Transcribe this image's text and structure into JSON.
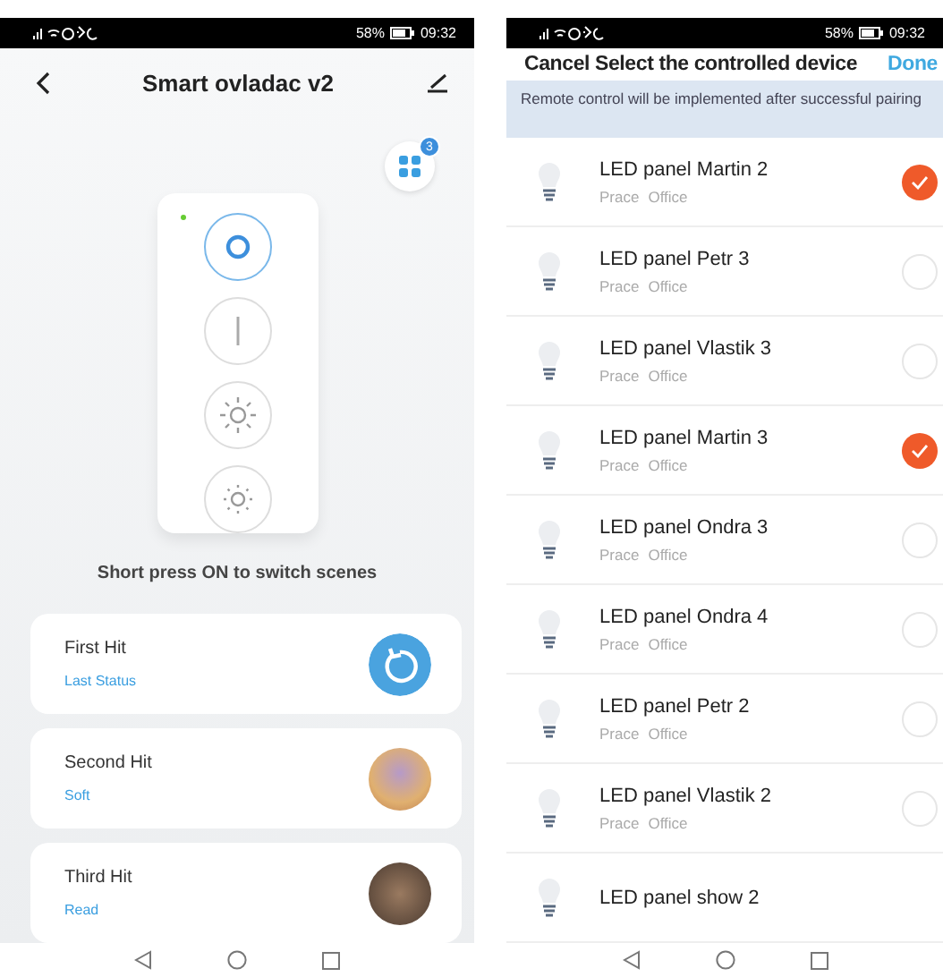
{
  "left_screen": {
    "status_bar": {
      "battery": "58%",
      "time": "09:32"
    },
    "title": "Smart ovladac v2",
    "scene_badge": "3",
    "hint": "Short press ON to switch scenes",
    "scenes": [
      {
        "name": "First Hit",
        "mode": "Last Status",
        "kind": "icon"
      },
      {
        "name": "Second Hit",
        "mode": "Soft",
        "kind": "photo"
      },
      {
        "name": "Third Hit",
        "mode": "Read",
        "kind": "photo"
      }
    ]
  },
  "right_screen": {
    "status_bar": {
      "battery": "58%",
      "time": "09:32"
    },
    "cancel": "Cancel",
    "title": "Select the controlled device",
    "done": "Done",
    "notice": "Remote control will be implemented after successful pairing",
    "devices": [
      {
        "name": "LED panel Martin 2",
        "home": "Prace",
        "room": "Office",
        "selected": true
      },
      {
        "name": "LED panel Petr 3",
        "home": "Prace",
        "room": "Office",
        "selected": false
      },
      {
        "name": "LED panel Vlastik 3",
        "home": "Prace",
        "room": "Office",
        "selected": false
      },
      {
        "name": "LED panel Martin 3",
        "home": "Prace",
        "room": "Office",
        "selected": true
      },
      {
        "name": "LED panel Ondra 3",
        "home": "Prace",
        "room": "Office",
        "selected": false
      },
      {
        "name": "LED panel Ondra 4",
        "home": "Prace",
        "room": "Office",
        "selected": false
      },
      {
        "name": "LED panel Petr 2",
        "home": "Prace",
        "room": "Office",
        "selected": false
      },
      {
        "name": "LED panel Vlastik 2",
        "home": "Prace",
        "room": "Office",
        "selected": false
      },
      {
        "name": "LED panel show 2"
      }
    ]
  }
}
